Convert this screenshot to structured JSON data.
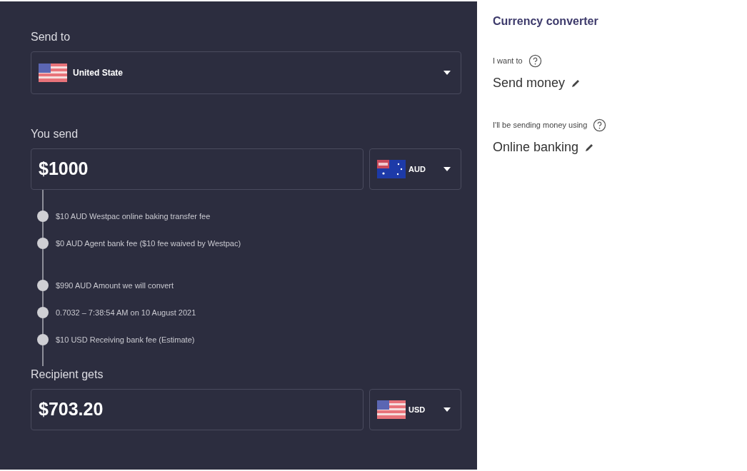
{
  "send_to": {
    "label": "Send to",
    "kind": "us",
    "value": "United State"
  },
  "you_send": {
    "label": "You send",
    "amount": "$1000",
    "currency": {
      "kind": "au",
      "code": "AUD"
    }
  },
  "fee_breakdown": [
    [
      "$10 AUD Westpac online baking transfer fee",
      "$0 AUD Agent bank fee ($10 fee waived by Westpac)"
    ],
    [
      "$990 AUD Amount we will convert",
      "0.7032 – 7:38:54 AM on 10 August 2021",
      "$10 USD Receiving bank fee (Estimate)"
    ]
  ],
  "recipient_gets": {
    "label": "Recipient gets",
    "amount": "$703.20",
    "currency": {
      "kind": "us",
      "code": "USD"
    }
  },
  "converter": {
    "title": "Currency converter",
    "fields": [
      {
        "label": "I want to",
        "value": "Send money"
      },
      {
        "label": "I'll be sending money using",
        "value": "Online banking"
      }
    ]
  }
}
